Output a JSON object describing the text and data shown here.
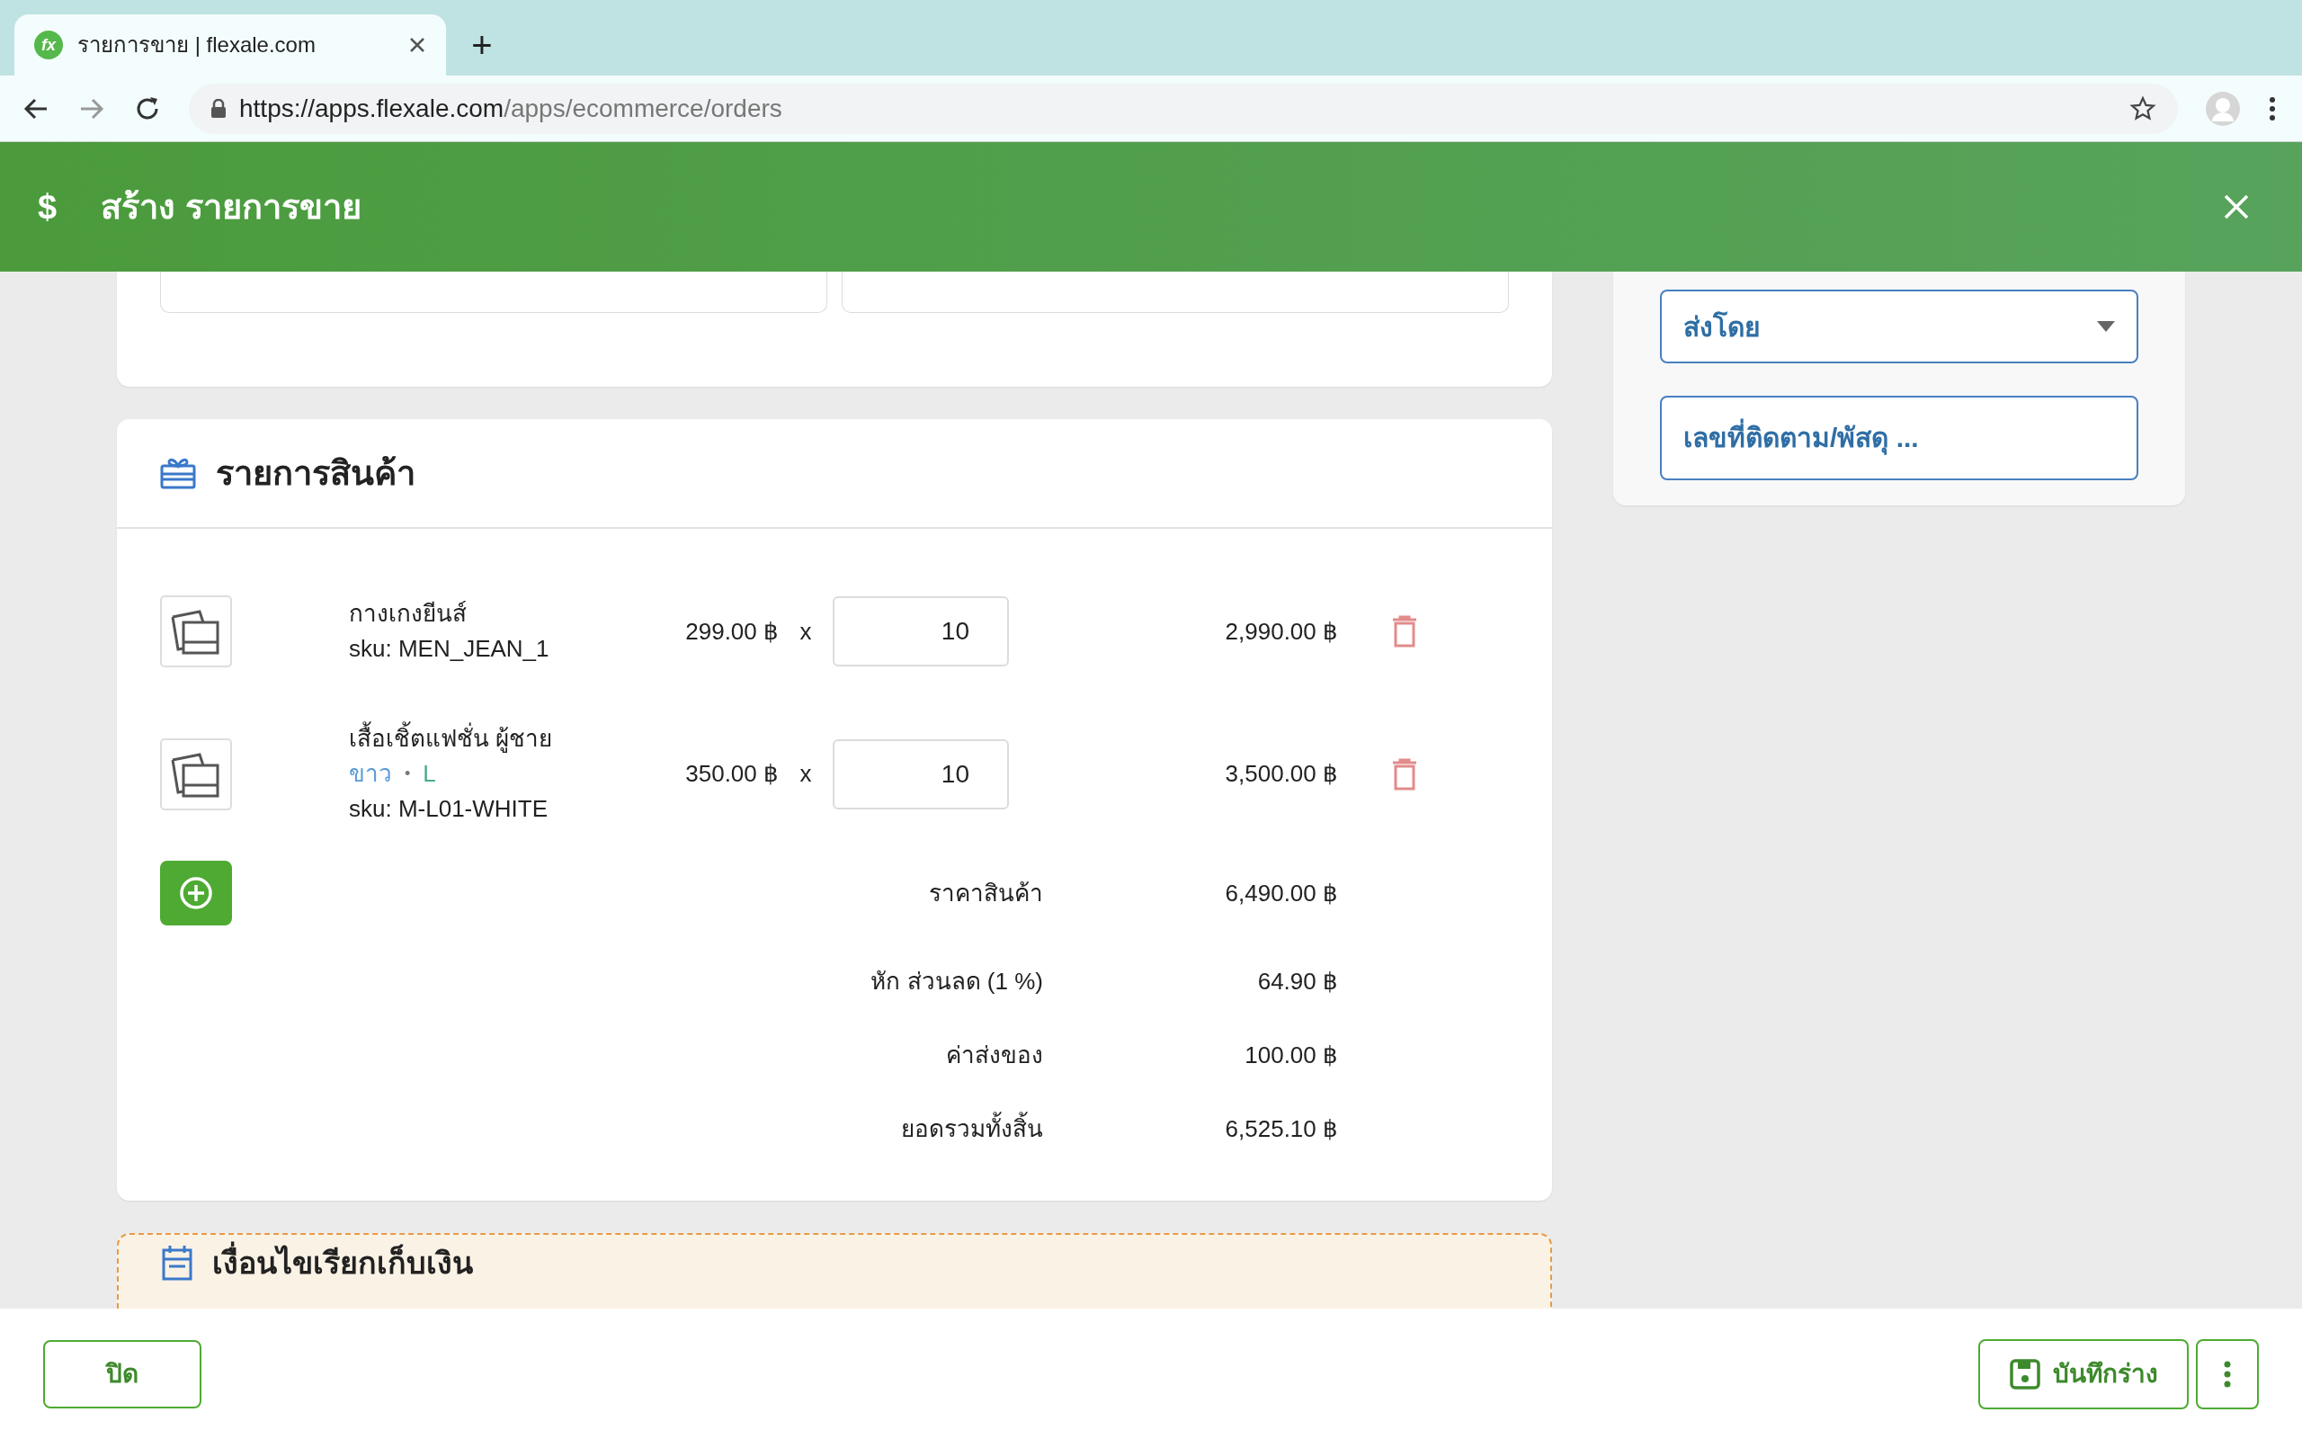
{
  "browser": {
    "favicon": "fx",
    "tab_title": "รายการขาย | flexale.com",
    "new_tab": "+",
    "url_host": "https://apps.flexale.com",
    "url_path": "/apps/ecommerce/orders"
  },
  "header": {
    "icon": "$",
    "title": "สร้าง รายการขาย"
  },
  "shipping": {
    "carrier_select": {
      "placeholder": "ส่งโดย"
    },
    "tracking_field": {
      "placeholder": "เลขที่ติดตาม/พัสดุ ..."
    }
  },
  "products": {
    "title": "รายการสินค้า",
    "items": [
      {
        "name": "กางเกงยีนส์",
        "sku": "sku: MEN_JEAN_1",
        "price": "299.00 ฿",
        "times": "x",
        "quantity": "10",
        "total": "2,990.00 ฿"
      },
      {
        "name": "เสื้อเชิ้ตแฟชั่น ผู้ชาย",
        "variants": [
          {
            "text": "ขาว",
            "color": "#5b9bd5"
          },
          {
            "text": "L",
            "color": "#4aaa8a"
          }
        ],
        "variant_separator": "•",
        "sku": "sku: M-L01-WHITE",
        "price": "350.00 ฿",
        "times": "x",
        "quantity": "10",
        "total": "3,500.00 ฿"
      }
    ],
    "summary": [
      {
        "label": "ราคาสินค้า",
        "value": "6,490.00 ฿"
      },
      {
        "label": "หัก ส่วนลด (1 %)",
        "value": "64.90 ฿"
      },
      {
        "label": "ค่าส่งของ",
        "value": "100.00 ฿"
      },
      {
        "label": "ยอดรวมทั้งสิ้น",
        "value": "6,525.10 ฿"
      }
    ]
  },
  "billing": {
    "title": "เงื่อนไขเรียกเก็บเงิน"
  },
  "footer": {
    "close_button": "ปิด",
    "save_button": "บันทึกร่าง"
  }
}
